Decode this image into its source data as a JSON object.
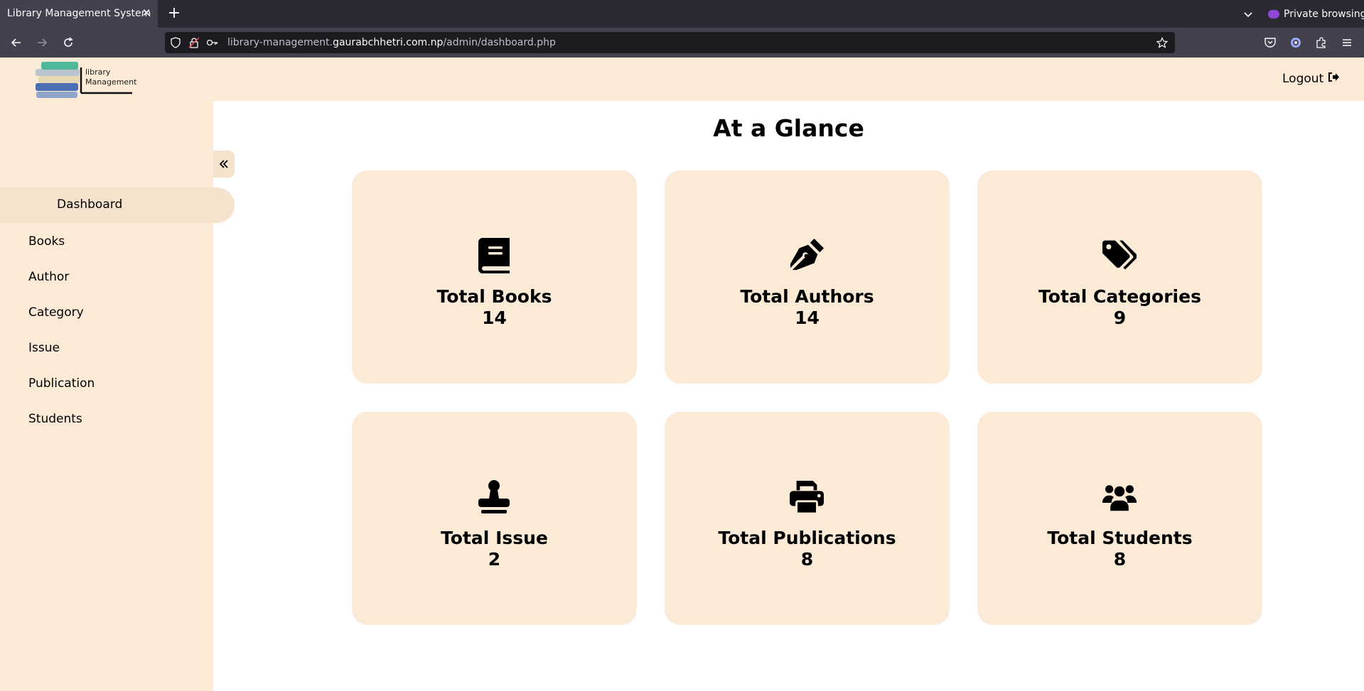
{
  "browser": {
    "tab_title": "Library Management System",
    "private_label": "Private browsing",
    "url_prefix": "library-management.",
    "url_domain": "gaurabchhetri.com.np",
    "url_path": "/admin/dashboard.php"
  },
  "header": {
    "logo_line1": "library",
    "logo_line2": "Management",
    "logout_label": "Logout"
  },
  "sidebar": {
    "items": [
      {
        "label": "Dashboard",
        "active": true
      },
      {
        "label": "Books"
      },
      {
        "label": "Author"
      },
      {
        "label": "Category"
      },
      {
        "label": "Issue"
      },
      {
        "label": "Publication"
      },
      {
        "label": "Students"
      }
    ]
  },
  "main": {
    "title": "At a Glance",
    "cards": [
      {
        "label": "Total Books",
        "value": "14",
        "icon": "book-icon"
      },
      {
        "label": "Total Authors",
        "value": "14",
        "icon": "pen-nib-icon"
      },
      {
        "label": "Total Categories",
        "value": "9",
        "icon": "tags-icon"
      },
      {
        "label": "Total Issue",
        "value": "2",
        "icon": "stamp-icon"
      },
      {
        "label": "Total Publications",
        "value": "8",
        "icon": "print-icon"
      },
      {
        "label": "Total Students",
        "value": "8",
        "icon": "users-icon"
      }
    ]
  },
  "colors": {
    "cream": "#fbead6",
    "cream_active": "#f5e2cc",
    "browser_dark": "#2b2a33",
    "browser_bar": "#42414d"
  }
}
